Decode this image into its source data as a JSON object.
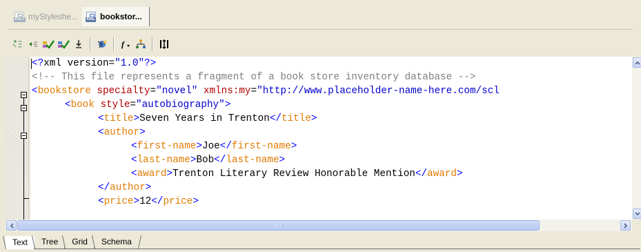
{
  "document_tabs": [
    {
      "label": "myStyleshe...",
      "icon": "xslt-file-icon",
      "icon_text": "XSLT",
      "active": false
    },
    {
      "label": "bookstor...",
      "icon": "xml-file-icon",
      "icon_text": "XML",
      "active": true
    }
  ],
  "toolbar": {
    "buttons": [
      "indent-icon",
      "outdent-icon",
      "check-well-formed-icon",
      "validate-icon",
      "download-icon",
      "xpath-icon",
      "insert-function-icon",
      "tree-icon",
      "split-icon"
    ]
  },
  "editor": {
    "lines": [
      {
        "indent": 0,
        "tokens": [
          {
            "t": "pi",
            "v": "<?"
          },
          {
            "t": "text",
            "v": "xml version="
          },
          {
            "t": "val",
            "v": "\"1.0\""
          },
          {
            "t": "pi",
            "v": "?>"
          }
        ]
      },
      {
        "indent": 0,
        "tokens": [
          {
            "t": "comment",
            "v": "<!-- This file represents a fragment of a book store inventory database -->"
          }
        ]
      },
      {
        "indent": 0,
        "tokens": [
          {
            "t": "tag",
            "v": "<"
          },
          {
            "t": "el",
            "v": "bookstore"
          },
          {
            "t": "text",
            "v": " "
          },
          {
            "t": "attr",
            "v": "specialty"
          },
          {
            "t": "text",
            "v": "="
          },
          {
            "t": "val",
            "v": "\"novel\""
          },
          {
            "t": "text",
            "v": " "
          },
          {
            "t": "attr",
            "v": "xmlns:my"
          },
          {
            "t": "text",
            "v": "="
          },
          {
            "t": "val",
            "v": "\"http://www.placeholder-name-here.com/scl"
          }
        ]
      },
      {
        "indent": 1,
        "tokens": [
          {
            "t": "tag",
            "v": "<"
          },
          {
            "t": "el",
            "v": "book"
          },
          {
            "t": "text",
            "v": " "
          },
          {
            "t": "attr",
            "v": "style"
          },
          {
            "t": "text",
            "v": "="
          },
          {
            "t": "val",
            "v": "\"autobiography\""
          },
          {
            "t": "tag",
            "v": ">"
          }
        ]
      },
      {
        "indent": 2,
        "tokens": [
          {
            "t": "tag",
            "v": "<"
          },
          {
            "t": "el",
            "v": "title"
          },
          {
            "t": "tag",
            "v": ">"
          },
          {
            "t": "text",
            "v": "Seven Years in Trenton"
          },
          {
            "t": "tag",
            "v": "</"
          },
          {
            "t": "el",
            "v": "title"
          },
          {
            "t": "tag",
            "v": ">"
          }
        ]
      },
      {
        "indent": 2,
        "tokens": [
          {
            "t": "tag",
            "v": "<"
          },
          {
            "t": "el",
            "v": "author"
          },
          {
            "t": "tag",
            "v": ">"
          }
        ]
      },
      {
        "indent": 3,
        "tokens": [
          {
            "t": "tag",
            "v": "<"
          },
          {
            "t": "el",
            "v": "first-name"
          },
          {
            "t": "tag",
            "v": ">"
          },
          {
            "t": "text",
            "v": "Joe"
          },
          {
            "t": "tag",
            "v": "</"
          },
          {
            "t": "el",
            "v": "first-name"
          },
          {
            "t": "tag",
            "v": ">"
          }
        ]
      },
      {
        "indent": 3,
        "tokens": [
          {
            "t": "tag",
            "v": "<"
          },
          {
            "t": "el",
            "v": "last-name"
          },
          {
            "t": "tag",
            "v": ">"
          },
          {
            "t": "text",
            "v": "Bob"
          },
          {
            "t": "tag",
            "v": "</"
          },
          {
            "t": "el",
            "v": "last-name"
          },
          {
            "t": "tag",
            "v": ">"
          }
        ]
      },
      {
        "indent": 3,
        "tokens": [
          {
            "t": "tag",
            "v": "<"
          },
          {
            "t": "el",
            "v": "award"
          },
          {
            "t": "tag",
            "v": ">"
          },
          {
            "t": "text",
            "v": "Trenton Literary Review Honorable Mention"
          },
          {
            "t": "tag",
            "v": "</"
          },
          {
            "t": "el",
            "v": "award"
          },
          {
            "t": "tag",
            "v": ">"
          }
        ]
      },
      {
        "indent": 2,
        "tokens": [
          {
            "t": "tag",
            "v": "</"
          },
          {
            "t": "el",
            "v": "author"
          },
          {
            "t": "tag",
            "v": ">"
          }
        ]
      },
      {
        "indent": 2,
        "tokens": [
          {
            "t": "tag",
            "v": "<"
          },
          {
            "t": "el",
            "v": "price"
          },
          {
            "t": "tag",
            "v": ">"
          },
          {
            "t": "text",
            "v": "12"
          },
          {
            "t": "tag",
            "v": "</"
          },
          {
            "t": "el",
            "v": "price"
          },
          {
            "t": "tag",
            "v": ">"
          }
        ]
      }
    ]
  },
  "view_tabs": [
    {
      "label": "Text",
      "active": true
    },
    {
      "label": "Tree",
      "active": false
    },
    {
      "label": "Grid",
      "active": false
    },
    {
      "label": "Schema",
      "active": false
    }
  ],
  "colors": {
    "tag": "#0000ff",
    "element": "#e07b00",
    "attribute": "#b00000",
    "value": "#0000cc",
    "comment": "#808080"
  }
}
